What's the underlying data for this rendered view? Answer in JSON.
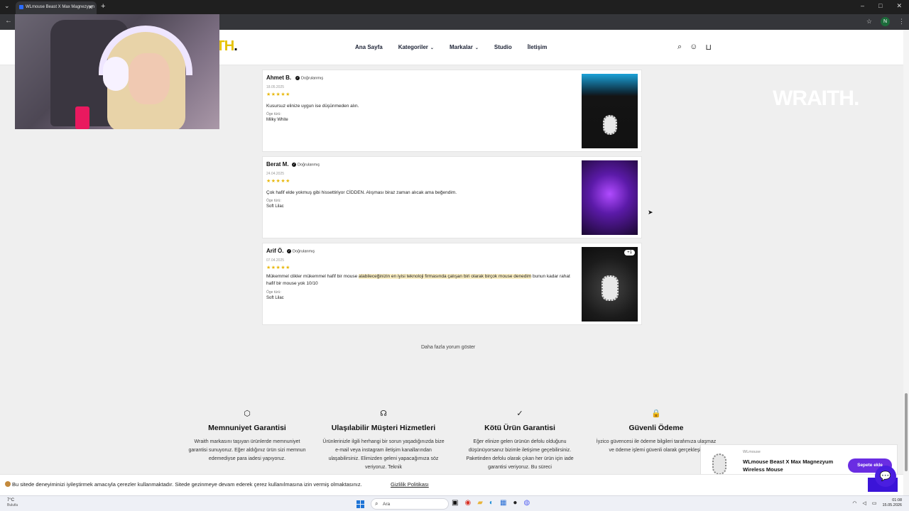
{
  "browser": {
    "tab_title": "WLmouse Beast X Max Magnezyum",
    "tab_close": "✕",
    "new_tab": "+",
    "tab_menu": "⌄",
    "back": "←",
    "bookmark_icon": "☆",
    "profile_initial": "N",
    "window_controls": [
      "–",
      "□",
      "✕"
    ]
  },
  "header": {
    "logo_main": "ITH",
    "logo_dot": ".",
    "nav": [
      {
        "label": "Ana Sayfa",
        "caret": ""
      },
      {
        "label": "Kategoriler",
        "caret": "⌄"
      },
      {
        "label": "Markalar",
        "caret": "⌄"
      },
      {
        "label": "Studio",
        "caret": ""
      },
      {
        "label": "İletişim",
        "caret": ""
      }
    ],
    "icons": {
      "search": "⌕",
      "account": "☺",
      "cart": "⊔"
    }
  },
  "watermark": "WRAITH.",
  "reviews": [
    {
      "name": "Ahmet B.",
      "verified": "Doğrulanmış",
      "date": "18.05.2025",
      "stars": "★★★★★",
      "rating": 5,
      "text_plain": "Kusursuz elinize uygun ise düşünmeden alın.",
      "text_highlight": "",
      "text_tail": "",
      "variant_label": "Öge türü:",
      "variant": "Milky White",
      "image_badge": ""
    },
    {
      "name": "Berat M.",
      "verified": "Doğrulanmış",
      "date": "24.04.2025",
      "stars": "★★★★★",
      "rating": 5,
      "text_plain": "Çok hafif elde yokmuş gibi hissettiriyor CİDDEN. Alışması biraz zaman alıcak ama beğendim.",
      "text_highlight": "",
      "text_tail": "",
      "variant_label": "Öge türü:",
      "variant": "Soft Lilac",
      "image_badge": ""
    },
    {
      "name": "Arif Ö.",
      "verified": "Doğrulanmış",
      "date": "07.04.2025",
      "stars": "★★★★★",
      "rating": 5,
      "text_plain": "Mükemmel clikler mükemmel hafif bir mouse ",
      "text_highlight": "alabileceğinizin en iyisi teknoloji firmasında çalışan biri olarak birçok mouse denedim",
      "text_tail": " bunun kadar rahat hafif bir mouse yok 10/10",
      "variant_label": "Öge türü:",
      "variant": "Soft Lilac",
      "image_badge": "+1"
    }
  ],
  "more_reviews": "Daha fazla yorum göster",
  "features": [
    {
      "icon": "⬡",
      "title": "Memnuniyet Garantisi",
      "text": "Wraith markasını taşıyan ürünlerde memnuniyet garantisi sunuyoruz. Eğer aldığınız ürün sizi memnun edemediyse para iadesi yapıyoruz."
    },
    {
      "icon": "☊",
      "title": "Ulaşılabilir Müşteri Hizmetleri",
      "text": "Ürünlerinizle ilgili herhangi bir sorun yaşadığınızda bize e-mail veya instagram iletişim kanallarından ulaşabilirsiniz. Elimizden geleni yapacağımıza söz veriyoruz. Teknik"
    },
    {
      "icon": "✓",
      "title": "Kötü Ürün Garantisi",
      "text": "Eğer elinize gelen ürünün defolu olduğunu düşünüyorsanız bizimle iletişime geçebilirsiniz. Paketinden defolu olarak çıkan her ürün için iade garantisi veriyoruz. Bu süreci"
    },
    {
      "icon": "🔒",
      "title": "Güvenli Ödeme",
      "text": "İyzico güvencesi ile ödeme bilgileri tarafımıza ulaşmaz ve ödeme işlemi güvenli olarak gerçekleşir."
    }
  ],
  "cart_popup": {
    "brand": "WLmouse",
    "product": "WLmouse Beast X Max Magnezyum Wireless Mouse",
    "button": "Sepete ekle"
  },
  "cookie": {
    "text": "Bu sitede deneyiminizi iyileştirmek amacıyla çerezler kullanmaktadır. Sitede gezinmeye devam ederek çerez kullanılmasına izin vermiş olmaktasınız.",
    "link": "Gizlilik Politikası",
    "button": "K"
  },
  "taskbar": {
    "temperature": "7°C",
    "weather": "Bulutlu",
    "search_placeholder": "Ara",
    "time": "01:08",
    "date": "15.05.2026"
  }
}
